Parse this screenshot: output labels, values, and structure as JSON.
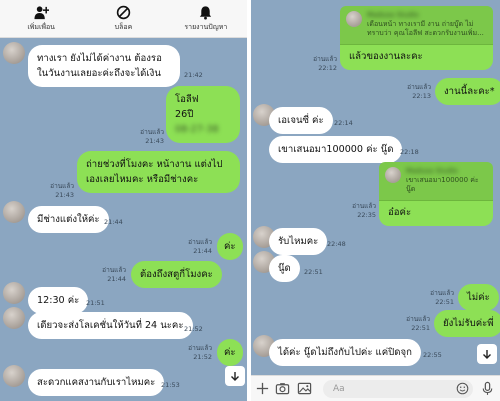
{
  "left_header": {
    "add_friend_label": "เพิ่มเพื่อน",
    "block_label": "บล็อค",
    "report_label": "รายงานปัญหา"
  },
  "left_messages": [
    {
      "text": "ทางเรา ยังไม่ได้ค่างาน ต้องรอในวันงานเลยอะค่ะถึงจะได้เงิน",
      "time": "21:42"
    },
    {
      "lines": [
        "โอลีฟ",
        "26ปี",
        "08-27-38"
      ],
      "read": "อ่านแล้ว",
      "time": "21:43"
    },
    {
      "text": "ถ่ายช่วงที่โมงคะ หน้างาน แต่งไปเองเลยไหมคะ หรือมีช่างคะ",
      "read": "อ่านแล้ว",
      "time": "21:43"
    },
    {
      "text": "มีช่างแต่งให้ค่ะ",
      "time": "21:44"
    },
    {
      "text": "ค่ะ",
      "read": "อ่านแล้ว",
      "time": "21:44"
    },
    {
      "text": "ต้องถึงสตูกี่โมงคะ",
      "read": "อ่านแล้ว",
      "time": "21:44"
    },
    {
      "text": "12:30 ค่ะ",
      "time": "21:51"
    },
    {
      "text": "เดียวจะส่งโลเคชั่นให้วันที่ 24 นะคะ",
      "time": "21:52"
    },
    {
      "text": "ค่ะ",
      "read": "อ่านแล้ว",
      "time": "21:52"
    },
    {
      "text": "สะดวกแคสงานกับเราไหมคะ",
      "time": "21:53"
    }
  ],
  "right_messages": [
    {
      "quote_name": "Madusa Studio",
      "quote_text": "เดือนหน้า ทางเรามี งาน ถ่ายบู๊ด ไม่ทราบว่า คุณโอลีฟ สะดวกรับงานเพิ่ม...",
      "text": "แล้วของงานละคะ",
      "read": "อ่านแล้ว",
      "time": "22:12"
    },
    {
      "text": "งานนี้ละคะ*",
      "read": "อ่านแล้ว",
      "time": "22:13"
    },
    {
      "text": "เอเจนซี่ ค่ะ",
      "time": "22:14"
    },
    {
      "text": "เขาเสนอมา100000 ค่ะ นู๊ด",
      "time": "22:18"
    },
    {
      "quote_name": "Madusa Studio",
      "quote_text": "เขาเสนอมา100000 ค่ะ นู๊ด",
      "text": "อ๋อค่ะ",
      "read": "อ่านแล้ว",
      "time": "22:35"
    },
    {
      "text": "รับไหมคะ",
      "time": "22:48"
    },
    {
      "text": "นู๊ด",
      "time": "22:51"
    },
    {
      "text": "ไม่ค่ะ",
      "read": "อ่านแล้ว",
      "time": "22:51"
    },
    {
      "text": "ยังไม่รับค่ะพี่",
      "read": "อ่านแล้ว",
      "time": "22:51"
    },
    {
      "text": "ได้ค่ะ นู๊ดไม่ถึงกับไปค่ะ แค่ปิดจุก",
      "time": "22:55"
    }
  ],
  "input": {
    "placeholder": "Aa"
  },
  "icons": {
    "add_friend": "person-plus-icon",
    "block": "block-icon",
    "report": "bell-icon",
    "scroll_down": "arrow-down-icon",
    "plus": "plus-icon",
    "camera": "camera-icon",
    "image": "image-icon",
    "emoji": "emoji-icon",
    "mic": "microphone-icon"
  },
  "colors": {
    "chat_background": "#8ba6c1",
    "outgoing_bubble": "#8de055",
    "incoming_bubble": "#ffffff"
  }
}
